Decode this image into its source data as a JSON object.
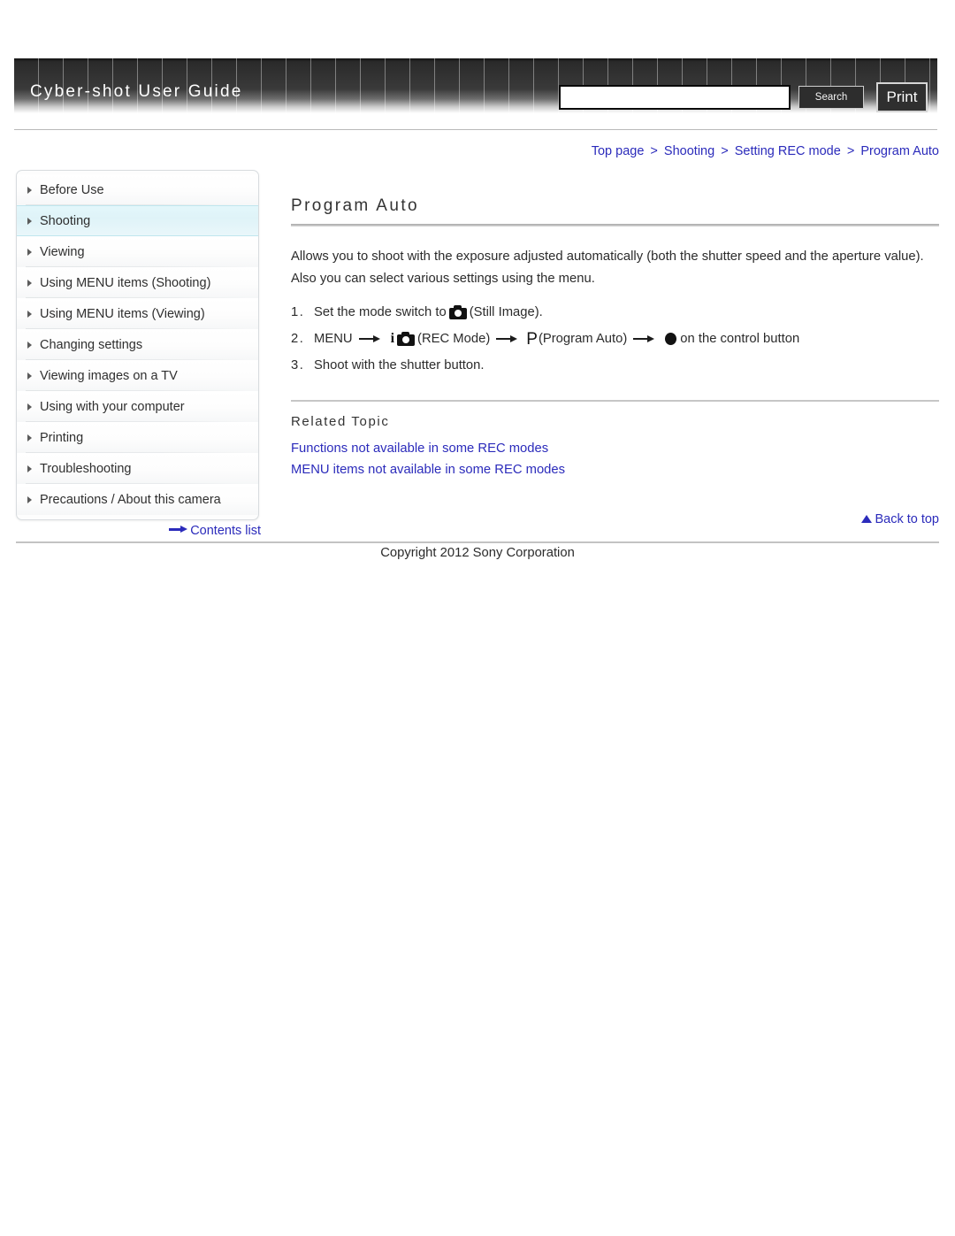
{
  "header": {
    "site_title": "Cyber-shot User Guide",
    "search_value": "",
    "search_placeholder": "",
    "search_label": "Search",
    "print_label": "Print"
  },
  "breadcrumb": {
    "items": [
      "Top page",
      "Shooting",
      "Setting REC mode",
      "Program Auto"
    ],
    "separator": ">",
    "link_color": "#2b2bbb"
  },
  "sidebar": {
    "items": [
      {
        "label": "Before Use",
        "active": false
      },
      {
        "label": "Shooting",
        "active": true
      },
      {
        "label": "Viewing",
        "active": false
      },
      {
        "label": "Using MENU items (Shooting)",
        "active": false
      },
      {
        "label": "Using MENU items (Viewing)",
        "active": false
      },
      {
        "label": "Changing settings",
        "active": false
      },
      {
        "label": "Viewing images on a TV",
        "active": false
      },
      {
        "label": "Using with your computer",
        "active": false
      },
      {
        "label": "Printing",
        "active": false
      },
      {
        "label": "Troubleshooting",
        "active": false
      },
      {
        "label": "Precautions / About this camera",
        "active": false
      }
    ],
    "contents_list_label": "Contents list",
    "highlight_color": "#dff3f8"
  },
  "main": {
    "title": "Program Auto",
    "intro": "Allows you to shoot with the exposure adjusted automatically (both the shutter speed and the aperture value). Also you can select various settings using the menu.",
    "steps": [
      {
        "number": "1.",
        "segments": [
          {
            "type": "text",
            "value": "Set the mode switch to "
          },
          {
            "type": "icon",
            "value": "camera-icon"
          },
          {
            "type": "text",
            "value": "(Still Image)."
          }
        ]
      },
      {
        "number": "2.",
        "segments": [
          {
            "type": "text",
            "value": "MENU"
          },
          {
            "type": "arrow",
            "value": "right-arrow"
          },
          {
            "type": "icon",
            "value": "i-camera-icon"
          },
          {
            "type": "text",
            "value": "(REC Mode)"
          },
          {
            "type": "arrow",
            "value": "right-arrow"
          },
          {
            "type": "glyph",
            "value": "P"
          },
          {
            "type": "text",
            "value": "(Program Auto)"
          },
          {
            "type": "arrow",
            "value": "right-arrow"
          },
          {
            "type": "icon",
            "value": "center-button-dot"
          },
          {
            "type": "text",
            "value": "on the control button"
          }
        ]
      },
      {
        "number": "3.",
        "segments": [
          {
            "type": "text",
            "value": "Shoot with the shutter button."
          }
        ]
      }
    ],
    "step1_text_a": "Set the mode switch to",
    "step1_text_b": "(Still Image).",
    "step2_text_a": "MENU",
    "step2_text_b": "(REC Mode)",
    "step2_glyph_p": "P",
    "step2_text_c": "(Program Auto)",
    "step2_text_d": "on the control button",
    "step3_text": "Shoot with the shutter button.",
    "related_heading": "Related Topic",
    "related_links": [
      "Functions not available in some REC modes",
      "MENU items not available in some REC modes"
    ],
    "back_to_top_label": "Back to top"
  },
  "footer": {
    "copyright": "Copyright 2012 Sony Corporation"
  }
}
